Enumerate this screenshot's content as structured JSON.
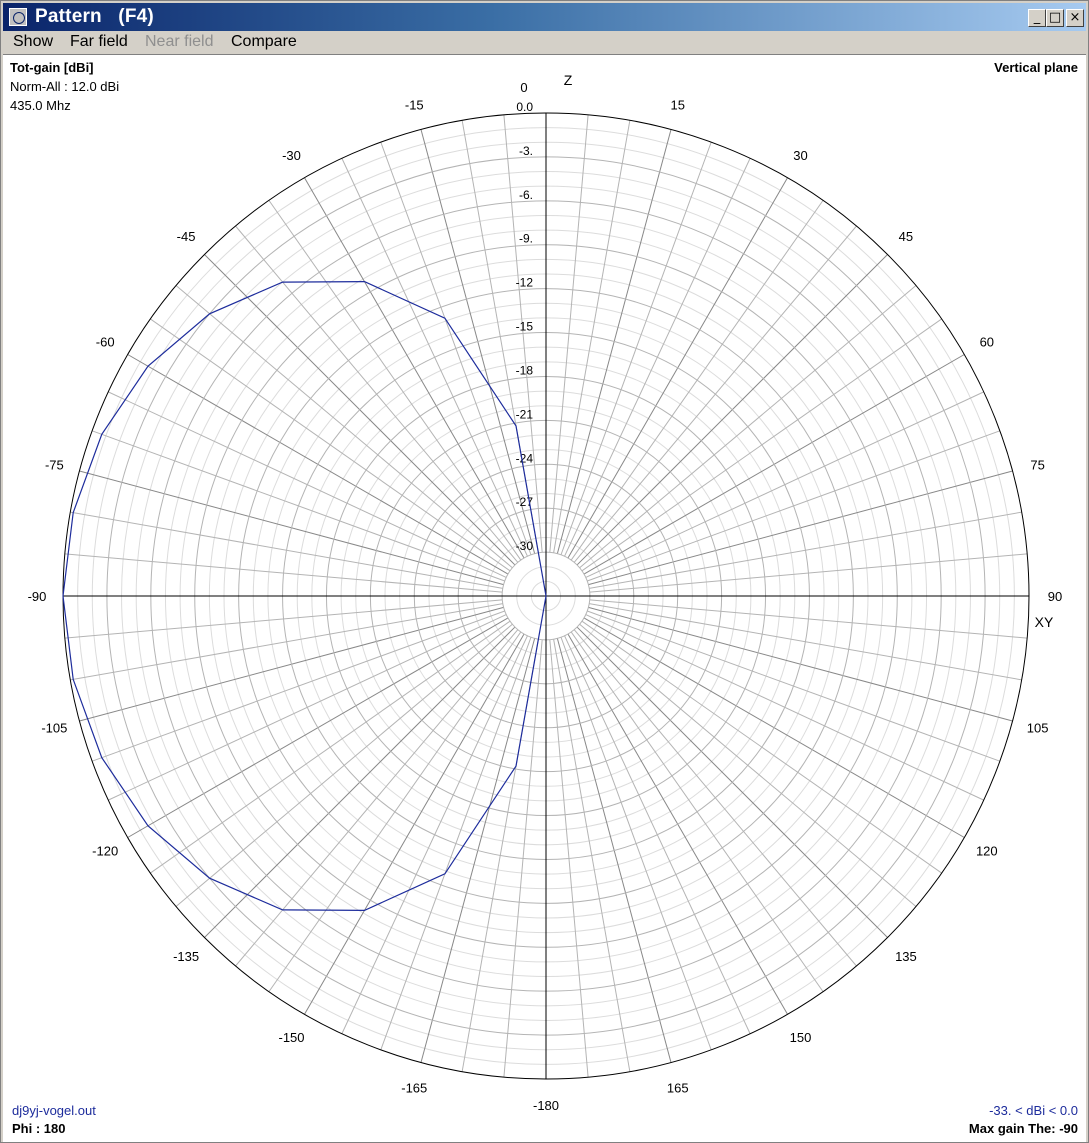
{
  "window": {
    "title": "Pattern   (F4)",
    "controls": {
      "minimize": "_",
      "maximize": "□",
      "close": "×"
    }
  },
  "menu": [
    {
      "label": "Show",
      "enabled": true
    },
    {
      "label": "Far field",
      "enabled": true
    },
    {
      "label": "Near field",
      "enabled": false
    },
    {
      "label": "Compare",
      "enabled": true
    }
  ],
  "info": {
    "quantity": "Tot-gain [dBi]",
    "norm": "Norm-All : 12.0 dBi",
    "frequency": "435.0 Mhz",
    "plane": "Vertical plane",
    "filename": "dj9yj-vogel.out",
    "phi": "Phi : 180",
    "range": "-33. < dBi < 0.0",
    "max_gain": "Max gain The: -90"
  },
  "axis_labels": {
    "top": "Z",
    "right": "XY"
  },
  "colors": {
    "trace": "#1d2c9c",
    "grid_major": "#b4b4b4",
    "grid_minor": "#dcdcdc"
  },
  "chart_data": {
    "type": "polar",
    "angle_unit": "deg",
    "angle_ticks": [
      {
        "deg": 0,
        "label": "0"
      },
      {
        "deg": 15,
        "label": "15"
      },
      {
        "deg": 30,
        "label": "30"
      },
      {
        "deg": 45,
        "label": "45"
      },
      {
        "deg": 60,
        "label": "60"
      },
      {
        "deg": 75,
        "label": "75"
      },
      {
        "deg": 90,
        "label": "90"
      },
      {
        "deg": 105,
        "label": "105"
      },
      {
        "deg": 120,
        "label": "120"
      },
      {
        "deg": 135,
        "label": "135"
      },
      {
        "deg": 150,
        "label": "150"
      },
      {
        "deg": 165,
        "label": "165"
      },
      {
        "deg": 180,
        "label": "-180"
      },
      {
        "deg": -165,
        "label": "-165"
      },
      {
        "deg": -150,
        "label": "-150"
      },
      {
        "deg": -135,
        "label": "-135"
      },
      {
        "deg": -120,
        "label": "-120"
      },
      {
        "deg": -105,
        "label": "-105"
      },
      {
        "deg": -90,
        "label": "-90"
      },
      {
        "deg": -75,
        "label": "-75"
      },
      {
        "deg": -60,
        "label": "-60"
      },
      {
        "deg": -45,
        "label": "-45"
      },
      {
        "deg": -30,
        "label": "-30"
      },
      {
        "deg": -15,
        "label": "-15"
      }
    ],
    "radial_range_dbi": [
      -33,
      0
    ],
    "radial_ticks": [
      {
        "value": 0,
        "label": "0.0"
      },
      {
        "value": -3,
        "label": "-3."
      },
      {
        "value": -6,
        "label": "-6."
      },
      {
        "value": -9,
        "label": "-9."
      },
      {
        "value": -12,
        "label": "-12"
      },
      {
        "value": -15,
        "label": "-15"
      },
      {
        "value": -18,
        "label": "-18"
      },
      {
        "value": -21,
        "label": "-21"
      },
      {
        "value": -24,
        "label": "-24"
      },
      {
        "value": -27,
        "label": "-27"
      },
      {
        "value": -30,
        "label": "-30"
      }
    ],
    "radial_minor_step": 1,
    "grid_angle_step": 5,
    "series": [
      {
        "theta_deg": [
          0,
          -10,
          -20,
          -30,
          -40,
          -50,
          -60,
          -70,
          -80,
          -90,
          -100,
          -110,
          -120,
          -130,
          -140,
          -150,
          -160,
          -170,
          -180
        ],
        "gain_dbi": [
          -33.0,
          -21.2,
          -12.8,
          -8.2,
          -5.0,
          -3.0,
          -1.6,
          -0.7,
          -0.2,
          0.0,
          -0.2,
          -0.7,
          -1.6,
          -3.0,
          -5.0,
          -8.2,
          -12.8,
          -21.2,
          -33.0
        ]
      }
    ]
  }
}
